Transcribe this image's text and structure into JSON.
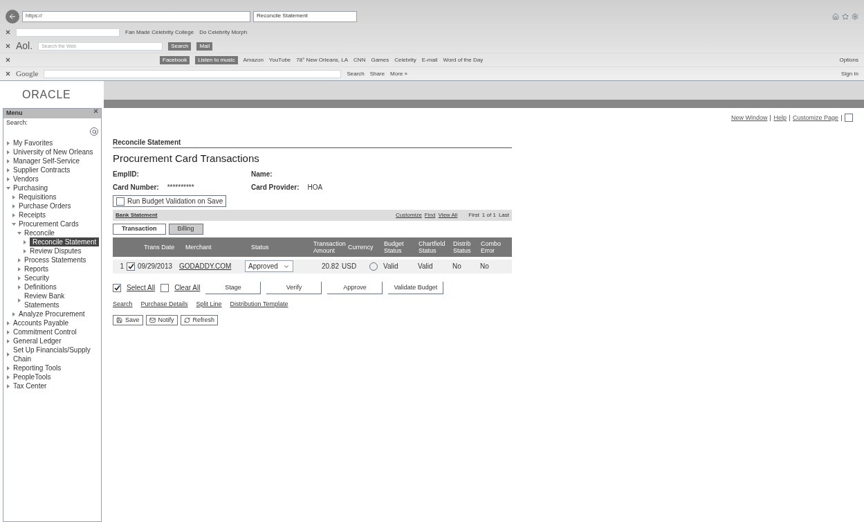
{
  "browser": {
    "address": "https://",
    "tab_title": "Reconcile Statement",
    "toolbar_rows": [
      {
        "kind": "plain",
        "items": [
          "Fan Made Celebrity College",
          "Do Celebrity Morph"
        ]
      },
      {
        "kind": "aol",
        "brand": "Aol.",
        "placeholder": "Search the Web",
        "items": [
          "Search",
          "Mail"
        ]
      },
      {
        "kind": "links",
        "items": [
          "Facebook",
          "Listen to music",
          "Amazon",
          "YouTube",
          "78° New Orleans, LA",
          "CNN",
          "Games",
          "Celebrity",
          "E-mail",
          "Word of the Day"
        ],
        "right": "Options"
      },
      {
        "kind": "google",
        "brand": "Google",
        "items": [
          "Search",
          "Share",
          "More »"
        ],
        "right": "Sign In"
      }
    ]
  },
  "header": {
    "logo": "ORACLE",
    "links": [
      "New Window",
      "Help",
      "Customize Page"
    ]
  },
  "menu": {
    "title": "Menu",
    "search_label": "Search:",
    "items": [
      {
        "label": "My Favorites",
        "expanded": false,
        "selected": false
      },
      {
        "label": "University of New Orleans",
        "expanded": false,
        "selected": false
      },
      {
        "label": "Manager Self-Service",
        "expanded": false,
        "selected": false
      },
      {
        "label": "Supplier Contracts",
        "expanded": false,
        "selected": false
      },
      {
        "label": "Vendors",
        "expanded": false,
        "selected": false
      },
      {
        "label": "Purchasing",
        "expanded": true,
        "selected": false,
        "children": [
          {
            "label": "Requisitions",
            "expanded": false,
            "selected": false
          },
          {
            "label": "Purchase Orders",
            "expanded": false,
            "selected": false
          },
          {
            "label": "Receipts",
            "expanded": false,
            "selected": false
          },
          {
            "label": "Procurement Cards",
            "expanded": true,
            "selected": false,
            "children": [
              {
                "label": "Reconcile",
                "expanded": true,
                "selected": false,
                "children": [
                  {
                    "label": "Reconcile Statement",
                    "expanded": false,
                    "selected": true
                  },
                  {
                    "label": "Review Disputes",
                    "expanded": false,
                    "selected": false
                  }
                ]
              },
              {
                "label": "Process Statements",
                "expanded": false,
                "selected": false
              },
              {
                "label": "Reports",
                "expanded": false,
                "selected": false
              },
              {
                "label": "Security",
                "expanded": false,
                "selected": false
              },
              {
                "label": "Definitions",
                "expanded": false,
                "selected": false
              },
              {
                "label": "Review Bank Statements",
                "expanded": false,
                "selected": false
              }
            ]
          },
          {
            "label": "Analyze Procurement",
            "expanded": false,
            "selected": false
          }
        ]
      },
      {
        "label": "Accounts Payable",
        "expanded": false,
        "selected": false
      },
      {
        "label": "Commitment Control",
        "expanded": false,
        "selected": false
      },
      {
        "label": "General Ledger",
        "expanded": false,
        "selected": false
      },
      {
        "label": "Set Up Financials/Supply Chain",
        "expanded": false,
        "selected": false
      },
      {
        "label": "Reporting Tools",
        "expanded": false,
        "selected": false
      },
      {
        "label": "PeopleTools",
        "expanded": false,
        "selected": false
      },
      {
        "label": "Tax Center",
        "expanded": false,
        "selected": false
      }
    ]
  },
  "page": {
    "breadcrumb": "Reconcile Statement",
    "title": "Procurement Card Transactions",
    "fields": [
      {
        "label": "EmplID:"
      },
      {
        "label": "Name:"
      },
      {
        "label": "Card Number:",
        "value": "**********"
      },
      {
        "label": "Card Provider:",
        "value": "HOA"
      }
    ],
    "run_budget": {
      "label": "Run Budget Validation on Save",
      "checked": false
    },
    "grid": {
      "title": "Bank Statement",
      "nav_links": [
        "Customize",
        "Find",
        "View All"
      ],
      "first": "First",
      "count": "1 of 1",
      "last": "Last",
      "tabs": [
        {
          "label": "Transaction",
          "selected": true
        },
        {
          "label": "Billing",
          "selected": false
        }
      ],
      "columns": [
        "Trans Date",
        "Merchant",
        "Status",
        "Transaction Amount",
        "Currency",
        "Budget Status",
        "Chartfield Status",
        "Distrib Status",
        "Combo Error"
      ],
      "rows": [
        {
          "num": "1",
          "checked": true,
          "date": "09/29/2013",
          "merchant": "GODADDY.COM",
          "status": "Approved",
          "amount": "20.82",
          "currency": "USD",
          "budget": "Valid",
          "chartfield": "Valid",
          "distrib": "No",
          "combo": "No"
        }
      ]
    },
    "select_all": {
      "label": "Select All",
      "checked": true
    },
    "clear_all": {
      "label": "Clear All",
      "checked": false
    },
    "actions": [
      "Stage",
      "Verify",
      "Approve",
      "Validate Budget"
    ],
    "links": [
      "Search",
      "Purchase Details",
      "Split Line",
      "Distribution Template"
    ],
    "buttons": [
      {
        "kind": "save",
        "label": "Save"
      },
      {
        "kind": "notify",
        "label": "Notify"
      },
      {
        "kind": "refresh",
        "label": "Refresh"
      }
    ]
  }
}
